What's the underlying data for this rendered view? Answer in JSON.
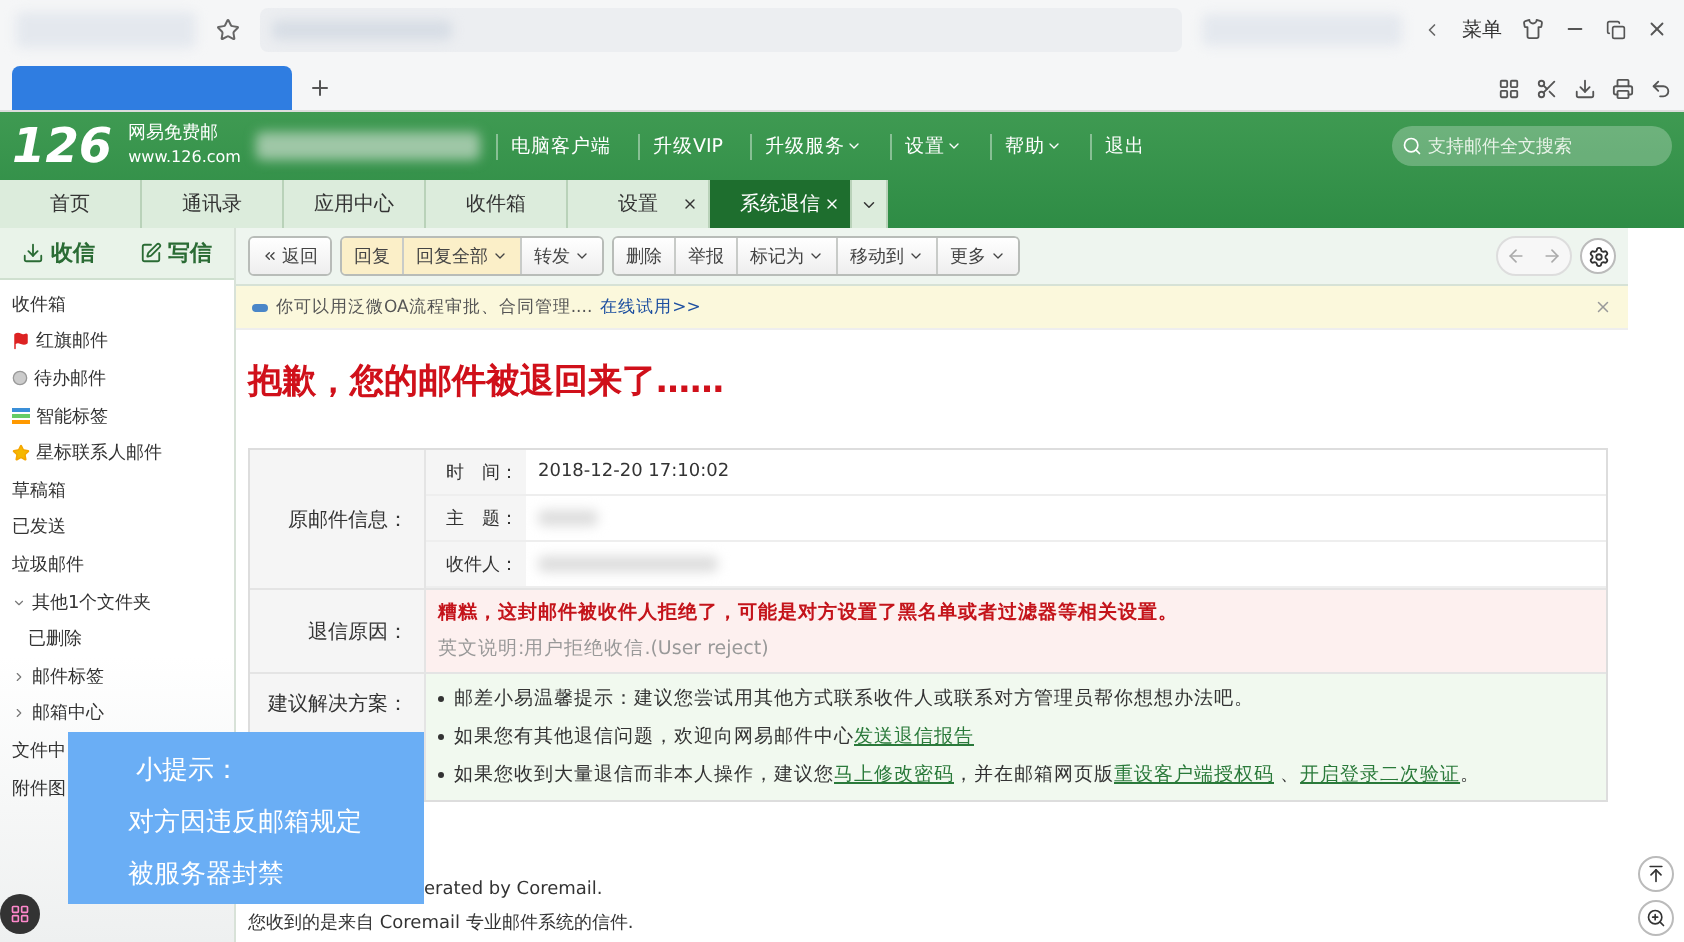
{
  "browser": {
    "menu_label": "菜单"
  },
  "header": {
    "logo_number": "126",
    "logo_name": "网易免费邮",
    "logo_url": "www.126.com",
    "nav": [
      {
        "label": "电脑客户端",
        "dropdown": false
      },
      {
        "label": "升级VIP",
        "dropdown": false
      },
      {
        "label": "升级服务",
        "dropdown": true
      },
      {
        "label": "设置",
        "dropdown": true
      },
      {
        "label": "帮助",
        "dropdown": true
      },
      {
        "label": "退出",
        "dropdown": false
      }
    ],
    "search": {
      "placeholder": "支持邮件全文搜索"
    }
  },
  "tabs": [
    {
      "label": "首页",
      "selected": false,
      "closable": false
    },
    {
      "label": "通讯录",
      "selected": false,
      "closable": false
    },
    {
      "label": "应用中心",
      "selected": false,
      "closable": false
    },
    {
      "label": "收件箱",
      "selected": false,
      "closable": false
    },
    {
      "label": "设置",
      "selected": false,
      "closable": true
    },
    {
      "label": "系统退信",
      "selected": true,
      "closable": true
    }
  ],
  "sidebar": {
    "receive": "收信",
    "compose": "写信",
    "items": [
      {
        "label": "收件箱",
        "kind": "plain"
      },
      {
        "label": "红旗邮件",
        "kind": "flag"
      },
      {
        "label": "待办邮件",
        "kind": "todo"
      },
      {
        "label": "智能标签",
        "kind": "tags"
      },
      {
        "label": "星标联系人邮件",
        "kind": "star"
      },
      {
        "label": "草稿箱",
        "kind": "plain"
      },
      {
        "label": "已发送",
        "kind": "plain"
      },
      {
        "label": "垃圾邮件",
        "kind": "plain"
      },
      {
        "label": "其他1个文件夹",
        "kind": "folder",
        "expanded": true,
        "children": [
          {
            "label": "已删除"
          }
        ]
      },
      {
        "label": "邮件标签",
        "kind": "folder",
        "expanded": false
      },
      {
        "label": "邮箱中心",
        "kind": "folder",
        "expanded": false
      },
      {
        "label": "文件中",
        "kind": "plain"
      },
      {
        "label": "附件图",
        "kind": "plain"
      }
    ]
  },
  "toolbar": [
    {
      "label": "返回",
      "kind": "back",
      "highlight": false,
      "dropdown": false
    },
    {
      "label": "回复",
      "kind": "action",
      "highlight": true,
      "dropdown": false
    },
    {
      "label": "回复全部",
      "kind": "action",
      "highlight": true,
      "dropdown": true
    },
    {
      "label": "转发",
      "kind": "action",
      "highlight": false,
      "dropdown": true
    },
    {
      "label": "删除",
      "kind": "action",
      "highlight": false,
      "dropdown": false
    },
    {
      "label": "举报",
      "kind": "action",
      "highlight": false,
      "dropdown": false
    },
    {
      "label": "标记为",
      "kind": "menu",
      "highlight": false,
      "dropdown": true
    },
    {
      "label": "移动到",
      "kind": "menu",
      "highlight": false,
      "dropdown": true
    },
    {
      "label": "更多",
      "kind": "menu",
      "highlight": false,
      "dropdown": true
    }
  ],
  "notice": {
    "text": "你可以用泛微OA流程审批、合同管理....",
    "link": "在线试用>>"
  },
  "title": "抱歉，您的邮件被退回来了……",
  "info": {
    "label": "原邮件信息：",
    "fields": [
      {
        "label": "时　间：",
        "value": "2018-12-20 17:10:02"
      },
      {
        "label": "主　题："
      },
      {
        "label": "收件人："
      }
    ]
  },
  "reason": {
    "label": "退信原因：",
    "text": "糟糕，这封邮件被收件人拒绝了，可能是对方设置了黑名单或者过滤器等相关设置。",
    "detail": "英文说明:用户拒绝收信.(User reject)"
  },
  "solutions": {
    "label": "建议解决方案：",
    "items": [
      [
        {
          "text": "邮差小易温馨提示：建议您尝试用其他方式联系收件人或联系对方管理员帮你想想办法吧。",
          "link": false
        }
      ],
      [
        {
          "text": "如果您有其他退信问题，欢迎向网易邮件中心",
          "link": false
        },
        {
          "text": "发送退信报告",
          "link": true
        }
      ],
      [
        {
          "text": "如果您收到大量退信而非本人操作，建议您",
          "link": false
        },
        {
          "text": "马上修改密码",
          "link": true
        },
        {
          "text": "，并在邮箱网页版",
          "link": false
        },
        {
          "text": "重设客户端授权码",
          "link": true
        },
        {
          "text": " 、",
          "link": false
        },
        {
          "text": "开启登录二次验证",
          "link": true
        },
        {
          "text": "。",
          "link": false
        }
      ]
    ]
  },
  "footer": {
    "line_1": "erated by Coremail.",
    "line_2": "您收到的是来自 Coremail 专业邮件系统的信件."
  },
  "tip": {
    "title": "小提示：",
    "lines": [
      "对方因违反邮箱规定",
      "被服务器封禁"
    ]
  }
}
